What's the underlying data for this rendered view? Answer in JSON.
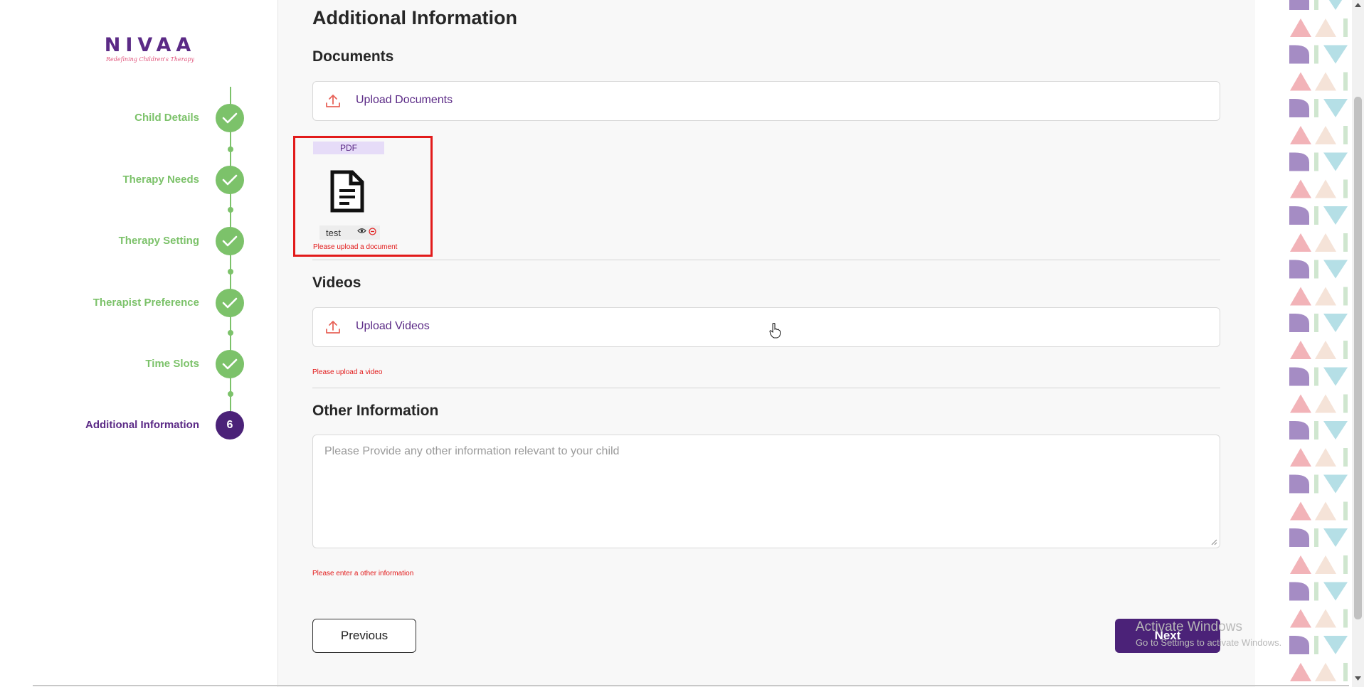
{
  "logo": {
    "name": "NIVAA",
    "tagline": "Redefining Children's Therapy"
  },
  "steps": [
    {
      "label": "Child Details",
      "status": "completed"
    },
    {
      "label": "Therapy Needs",
      "status": "completed"
    },
    {
      "label": "Therapy Setting",
      "status": "completed"
    },
    {
      "label": "Therapist Preference",
      "status": "completed"
    },
    {
      "label": "Time Slots",
      "status": "completed"
    },
    {
      "label": "Additional Information",
      "status": "active",
      "number": "6"
    }
  ],
  "page": {
    "title": "Additional Information"
  },
  "documents": {
    "title": "Documents",
    "upload_label": "Upload Documents",
    "file": {
      "type": "PDF",
      "name": "test"
    },
    "error": "Please upload a document"
  },
  "videos": {
    "title": "Videos",
    "upload_label": "Upload Videos",
    "error": "Please upload a video"
  },
  "other": {
    "title": "Other Information",
    "placeholder": "Please Provide any other information relevant to your child",
    "error": "Please enter a other information"
  },
  "buttons": {
    "previous": "Previous",
    "next": "Next"
  },
  "watermark": {
    "title": "Activate Windows",
    "subtitle": "Go to Settings to activate Windows."
  },
  "colors": {
    "brand": "#5b2a86",
    "completed": "#7cc26a",
    "error": "#e21b1b",
    "accent": "#e8645a"
  }
}
